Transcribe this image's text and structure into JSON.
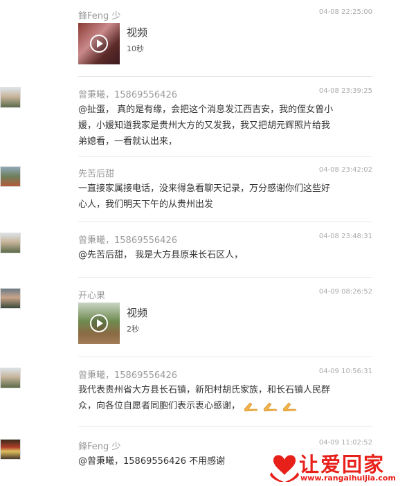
{
  "messages": [
    {
      "name": "鋒Feng 少",
      "time": "04-08 22:25:00",
      "video": {
        "label": "视频",
        "duration": "10秒"
      }
    },
    {
      "name": "曾秉曦，15869556426",
      "time": "04-08 23:39:25",
      "text_lines": [
        "@扯蛋， 真的是有缘，会把这个消息发江西吉安，我的侄女曾小",
        "媛，小媛知道我家是贵州大方的又发我，我又把胡元辉照片给我",
        "弟媳看，一看就认出来，"
      ]
    },
    {
      "name": "先苦后甜",
      "time": "04-08 23:42:02",
      "text_lines": [
        "一直接家属接电话，没来得急看聊天记录，万分感谢你们这些好",
        "心人，我们明天下午的从贵州出发"
      ]
    },
    {
      "name": "曾秉曦，15869556426",
      "time": "04-08 23:48:31",
      "text_lines": [
        "@先苦后甜， 我是大方县原来长石区人，"
      ]
    },
    {
      "name": "开心果",
      "time": "04-09 08:26:52",
      "video": {
        "label": "视频",
        "duration": "2秒"
      }
    },
    {
      "name": "曾秉曦，15869556426",
      "time": "04-09 10:56:31",
      "text_lines": [
        "我代表贵州省大方县长石镇，新阳村胡氏家族，和长石镇人民群",
        "众，向各位自愿者同胞们表示衷心感谢，"
      ]
    },
    {
      "name": "鋒Feng 少",
      "time": "04-09 11:02:52",
      "text_lines": [
        "@曾秉曦，15869556426 不用感谢"
      ]
    }
  ],
  "watermark": {
    "title": "让爱回家",
    "url": "www.rangaihuijia.com",
    "color": "#e8201a"
  }
}
